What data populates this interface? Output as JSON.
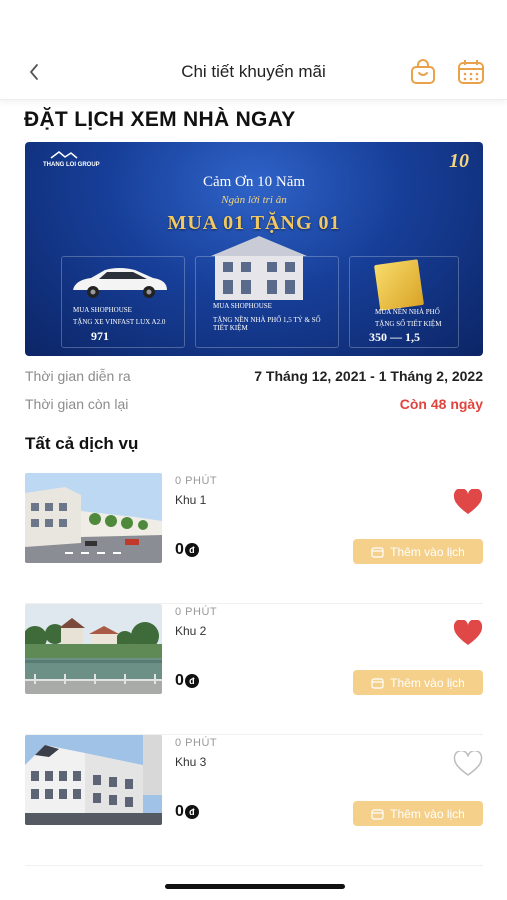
{
  "header": {
    "title": "Chi tiết khuyến mãi",
    "back_icon": "chevron-left-icon",
    "bag_icon": "shopping-bag-icon",
    "calendar_icon": "calendar-icon"
  },
  "promo": {
    "title": "ĐẶT LỊCH XEM NHÀ NGAY",
    "banner": {
      "brand": "THANG LOI GROUP",
      "anniversary": "10",
      "thanks": "Cảm Ơn 10 Năm",
      "thanks_sub": "Ngàn lời tri ân",
      "headline": "MUA 01 TẶNG 01",
      "panel1_line1": "MUA  SHOPHOUSE",
      "panel1_line2": "TẶNG XE VINFAST LUX A2.0",
      "panel1_value": "971",
      "panel2_line1": "MUA  SHOPHOUSE",
      "panel2_line2": "TẶNG NỀN NHÀ PHỐ 1,5 TỶ & SỔ TIẾT KIỆM",
      "panel3_line1": "MUA  NỀN NHÀ PHỐ",
      "panel3_line2": "TẶNG SỔ TIẾT KIỆM",
      "panel3_value": "350 — 1,5"
    }
  },
  "info": {
    "time_label": "Thời gian diễn ra",
    "time_value": "7 Tháng 12, 2021 - 1 Tháng 2, 2022",
    "remaining_label": "Thời gian còn lại",
    "remaining_value": "Còn 48 ngày"
  },
  "services": {
    "title": "Tất cả dịch vụ",
    "items": [
      {
        "duration": "0 PHÚT",
        "name": "Khu 1",
        "price": "0",
        "currency": "đ",
        "favorite": true,
        "add_label": "Thêm vào lịch"
      },
      {
        "duration": "0 PHÚT",
        "name": "Khu 2",
        "price": "0",
        "currency": "đ",
        "favorite": true,
        "add_label": "Thêm vào lịch"
      },
      {
        "duration": "0 PHÚT",
        "name": "Khu 3",
        "price": "0",
        "currency": "đ",
        "favorite": false,
        "add_label": "Thêm vào lịch"
      }
    ]
  },
  "colors": {
    "accent": "#f4d08b",
    "heart_active": "#e04848",
    "remaining": "#e0443e",
    "icon_orange": "#e9a24a"
  }
}
